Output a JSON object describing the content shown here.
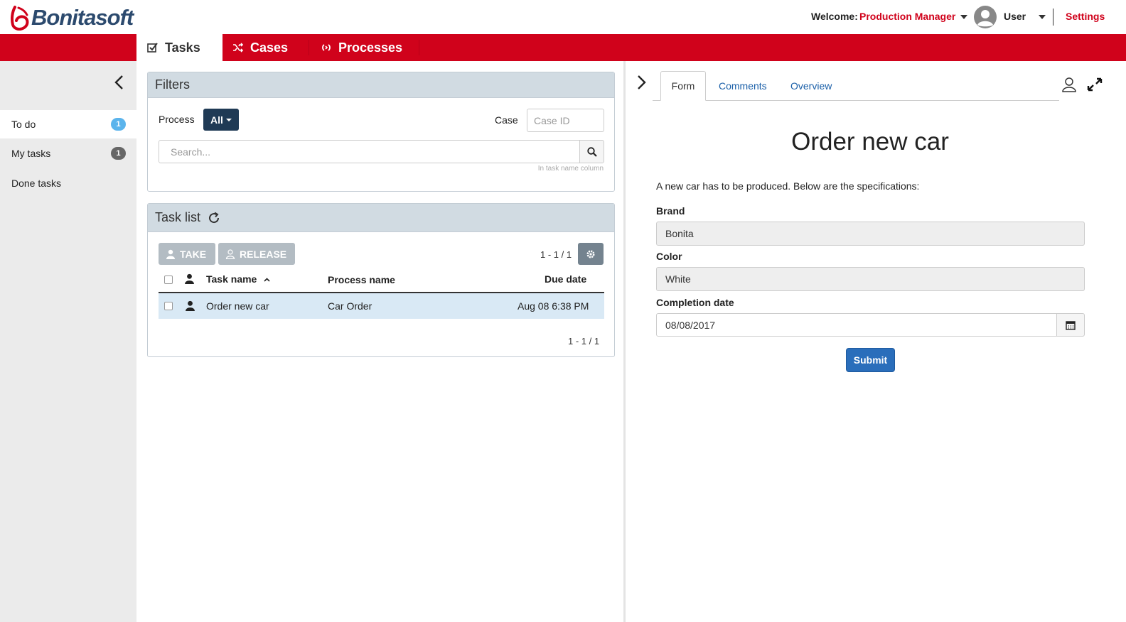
{
  "header": {
    "brand": "Bonitasoft",
    "welcome_label": "Welcome:",
    "profile": "Production Manager",
    "user": "User",
    "settings": "Settings",
    "brand_color": "#d0021b"
  },
  "nav": {
    "tabs": [
      {
        "label": "Tasks",
        "icon": "check-square-icon",
        "active": true
      },
      {
        "label": "Cases",
        "icon": "shuffle-icon",
        "active": false
      },
      {
        "label": "Processes",
        "icon": "cycle-icon",
        "active": false
      }
    ]
  },
  "sidebar": {
    "items": [
      {
        "label": "To do",
        "count": "1",
        "badge_color": "#5bb4ec",
        "active": true
      },
      {
        "label": "My tasks",
        "count": "1",
        "badge_color": "#666666",
        "active": false
      },
      {
        "label": "Done tasks",
        "count": "",
        "active": false
      }
    ]
  },
  "filters": {
    "title": "Filters",
    "process_label": "Process",
    "process_value": "All",
    "case_label": "Case",
    "case_placeholder": "Case ID",
    "search_placeholder": "Search...",
    "search_hint": "In task name column"
  },
  "tasklist": {
    "title": "Task list",
    "take_label": "TAKE",
    "release_label": "RELEASE",
    "pager_top": "1 - 1 / 1",
    "pager_bottom": "1 - 1 / 1",
    "columns": {
      "task_name": "Task name",
      "process_name": "Process name",
      "due_date": "Due date"
    },
    "rows": [
      {
        "task_name": "Order new car",
        "process_name": "Car Order",
        "due_date": "Aug 08 6:38 PM"
      }
    ]
  },
  "detail": {
    "tabs": {
      "form": "Form",
      "comments": "Comments",
      "overview": "Overview"
    },
    "form": {
      "title": "Order new car",
      "description": "A new car has to be produced. Below are the specifications:",
      "brand_label": "Brand",
      "brand_value": "Bonita",
      "color_label": "Color",
      "color_value": "White",
      "date_label": "Completion date",
      "date_value": "08/08/2017",
      "submit_label": "Submit"
    }
  }
}
